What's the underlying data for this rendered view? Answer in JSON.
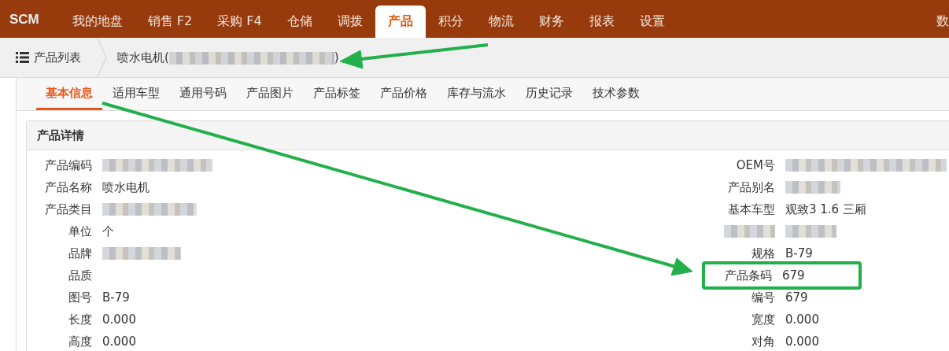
{
  "topbar": {
    "logo": "SCM",
    "menu": [
      {
        "label": "我的地盘",
        "selected": false
      },
      {
        "label": "销售 F2",
        "selected": false
      },
      {
        "label": "采购 F4",
        "selected": false
      },
      {
        "label": "仓储",
        "selected": false
      },
      {
        "label": "调拨",
        "selected": false
      },
      {
        "label": "产品",
        "selected": true
      },
      {
        "label": "积分",
        "selected": false
      },
      {
        "label": "物流",
        "selected": false
      },
      {
        "label": "财务",
        "selected": false
      },
      {
        "label": "报表",
        "selected": false
      },
      {
        "label": "设置",
        "selected": false
      },
      {
        "label": "数",
        "selected": false
      }
    ]
  },
  "breadcrumb": {
    "root": "产品列表",
    "current_prefix": "喷水电机(",
    "current_blurred": true,
    "current_suffix": ")"
  },
  "subtabs": [
    {
      "label": "基本信息",
      "selected": true
    },
    {
      "label": "适用车型",
      "selected": false
    },
    {
      "label": "通用号码",
      "selected": false
    },
    {
      "label": "产品图片",
      "selected": false
    },
    {
      "label": "产品标签",
      "selected": false
    },
    {
      "label": "产品价格",
      "selected": false
    },
    {
      "label": "库存与流水",
      "selected": false
    },
    {
      "label": "历史记录",
      "selected": false
    },
    {
      "label": "技术参数",
      "selected": false
    }
  ],
  "panel": {
    "title": "产品详情",
    "rows": [
      {
        "left": {
          "label": "产品编码",
          "value_blurred": true
        },
        "right": {
          "label": "OEM号",
          "value_blurred": true,
          "highlighted": false
        }
      },
      {
        "left": {
          "label": "产品名称",
          "value": "喷水电机"
        },
        "right": {
          "label": "产品别名",
          "value_blurred": true,
          "highlighted": false
        }
      },
      {
        "left": {
          "label": "产品类目",
          "value_blurred": true
        },
        "right": {
          "label": "基本车型",
          "value": "观致3 1.6 三厢",
          "highlighted": false
        }
      },
      {
        "left": {
          "label": "单位",
          "value": "个"
        },
        "right": {
          "label_blurred": true,
          "value_blurred": true,
          "highlighted": false
        }
      },
      {
        "left": {
          "label": "品牌",
          "value_blurred": true
        },
        "right": {
          "label": "规格",
          "value": "B-79",
          "highlighted": false
        }
      },
      {
        "left": {
          "label": "品质"
        },
        "right": {
          "label": "产品条码",
          "value": "679",
          "highlighted": true
        }
      },
      {
        "left": {
          "label": "图号",
          "value": "B-79"
        },
        "right": {
          "label": "编号",
          "value": "679",
          "highlighted": false
        }
      },
      {
        "left": {
          "label": "长度",
          "value": "0.000"
        },
        "right": {
          "label": "宽度",
          "value": "0.000",
          "highlighted": false
        }
      },
      {
        "left": {
          "label": "高度",
          "value": "0.000"
        },
        "right": {
          "label": "对角",
          "value": "0.000",
          "highlighted": false
        }
      }
    ]
  }
}
